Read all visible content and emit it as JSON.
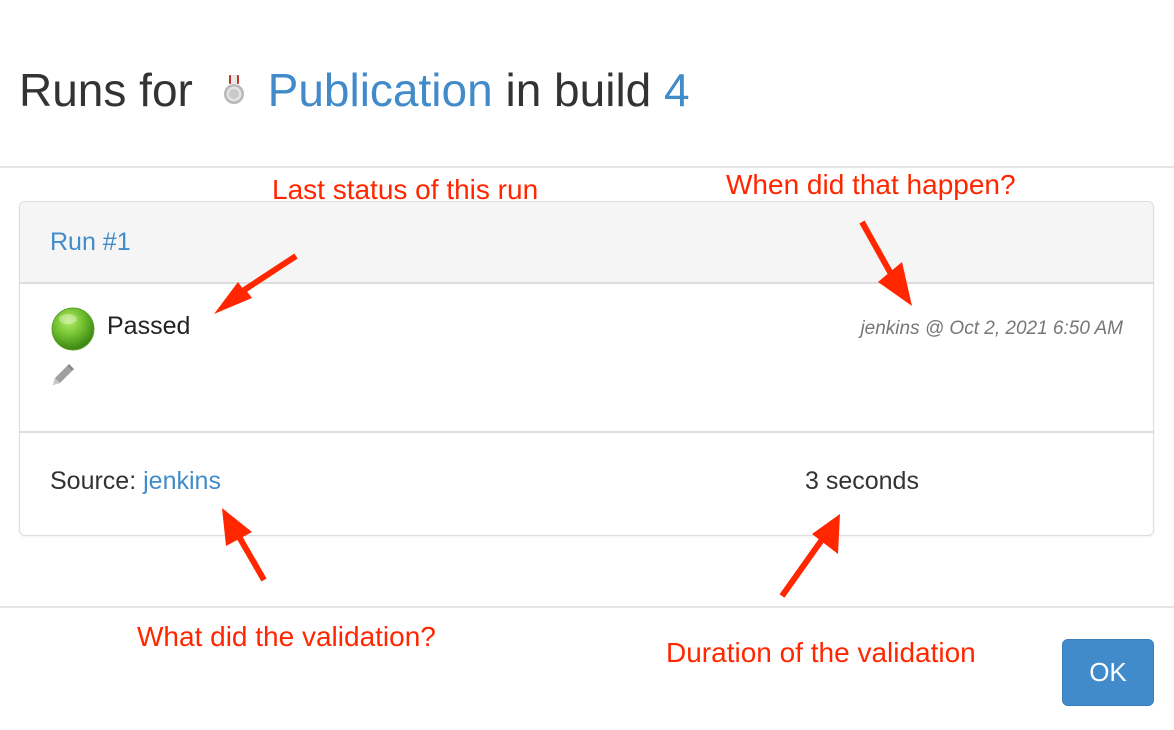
{
  "title": {
    "prefix": "Runs for",
    "promotion_name": "Publication",
    "middle": "in build",
    "build_number": "4"
  },
  "icons": {
    "promotion": "medal-icon",
    "status": "green-circle-icon",
    "edit": "pencil-icon"
  },
  "run": {
    "label": "Run #1",
    "status": "Passed",
    "timestamp": "jenkins @ Oct 2, 2021 6:50 AM",
    "source_label": "Source:",
    "source_value": "jenkins",
    "duration": "3 seconds"
  },
  "buttons": {
    "ok": "OK"
  },
  "annotations": {
    "last_status": "Last status of this run",
    "when": "When did that happen?",
    "what": "What did the validation?",
    "duration": "Duration of the validation"
  },
  "colors": {
    "link": "#428bca",
    "annotation": "#ff2600",
    "status_passed": "#6fbf2e",
    "button": "#428bca"
  }
}
